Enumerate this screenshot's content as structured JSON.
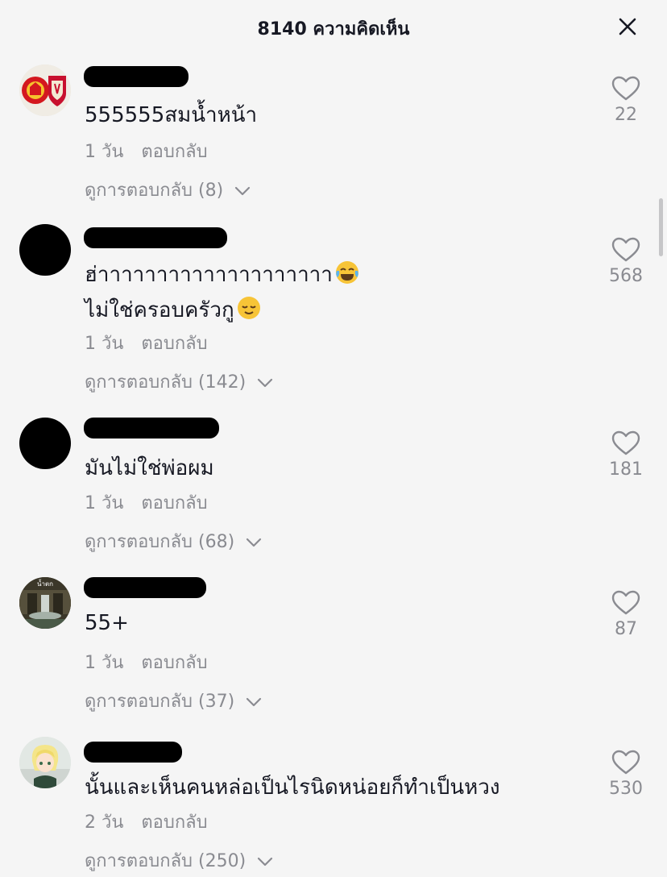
{
  "header": {
    "title": "8140 ความคิดเห็น"
  },
  "comments": [
    {
      "lines": [
        "555555สมน้ำหน้า"
      ],
      "time": "1 วัน",
      "reply_label": "ตอบกลับ",
      "view_replies": "ดูการตอบกลับ (8)",
      "likes": "22"
    },
    {
      "lines": [
        "ฮ่าาาาาาาาาาาาาาาาาาาา",
        "ไม่ใช่ครอบครัวกู"
      ],
      "emoji": [
        "face-with-tears-of-joy",
        "relieved-face"
      ],
      "time": "1 วัน",
      "reply_label": "ตอบกลับ",
      "view_replies": "ดูการตอบกลับ (142)",
      "likes": "568"
    },
    {
      "lines": [
        "มันไม่ใช่พ่อผม"
      ],
      "time": "1 วัน",
      "reply_label": "ตอบกลับ",
      "view_replies": "ดูการตอบกลับ (68)",
      "likes": "181"
    },
    {
      "lines": [
        "55+"
      ],
      "avatar_text": "น้ำตก",
      "time": "1 วัน",
      "reply_label": "ตอบกลับ",
      "view_replies": "ดูการตอบกลับ (37)",
      "likes": "87"
    },
    {
      "lines": [
        "นั้นและเห็นคนหล่อเป็นไรนิดหน่อยก็ทำเป็นหวง"
      ],
      "time": "2 วัน",
      "reply_label": "ตอบกลับ",
      "view_replies": "ดูการตอบกลับ (250)",
      "likes": "530"
    }
  ],
  "colors": {
    "background": "#f5f5f5",
    "text_primary": "#161823",
    "text_secondary": "#8a8b91"
  },
  "icons": [
    "close-icon",
    "heart-outline-icon",
    "chevron-down-icon"
  ]
}
